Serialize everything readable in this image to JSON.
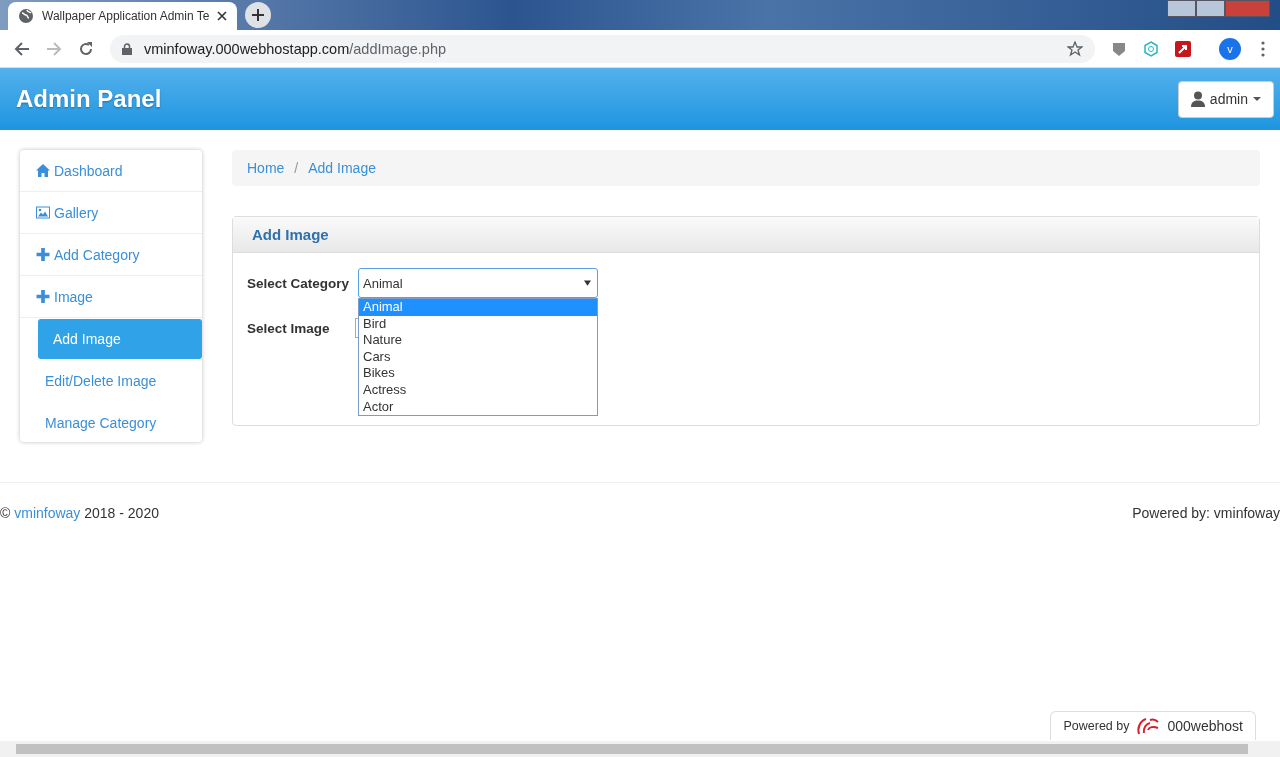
{
  "browser": {
    "tab_title": "Wallpaper Application Admin Te",
    "url_host": "vminfoway.000webhostapp.com",
    "url_path": "/addImage.php",
    "profile_letter": "v"
  },
  "header": {
    "brand": "Admin Panel",
    "user": "admin"
  },
  "sidebar": {
    "items": [
      {
        "label": "Dashboard",
        "kind": "home",
        "selected": false
      },
      {
        "label": "Gallery",
        "kind": "gallery",
        "selected": false
      },
      {
        "label": "Add Category",
        "kind": "add",
        "selected": false
      },
      {
        "label": "Image",
        "kind": "add",
        "selected": false,
        "children": [
          {
            "label": "Add Image",
            "selected": true
          },
          {
            "label": "Edit/Delete Image",
            "selected": false
          },
          {
            "label": "Manage Category",
            "selected": false
          }
        ]
      }
    ]
  },
  "breadcrumb": [
    "Home",
    "Add Image"
  ],
  "breadcrumb_separator": "/",
  "panel": {
    "title": "Add Image",
    "category": {
      "label": "Select Category",
      "value": "Animal",
      "expanded": true,
      "options": [
        {
          "label": "Animal",
          "selected": true
        },
        {
          "label": "Bird",
          "selected": false
        },
        {
          "label": "Nature",
          "selected": false
        },
        {
          "label": "Cars",
          "selected": false
        },
        {
          "label": "Bikes",
          "selected": false
        },
        {
          "label": "Actress",
          "selected": false
        },
        {
          "label": "Actor",
          "selected": false
        }
      ]
    },
    "image": {
      "label": "Select Image"
    }
  },
  "footer": {
    "copyright": "©",
    "link": "vminfoway",
    "years": "2018 - 2020",
    "powered": "Powered by: vminfoway"
  },
  "host_badge": {
    "prefix": "Powered by",
    "name": "000webhost"
  }
}
